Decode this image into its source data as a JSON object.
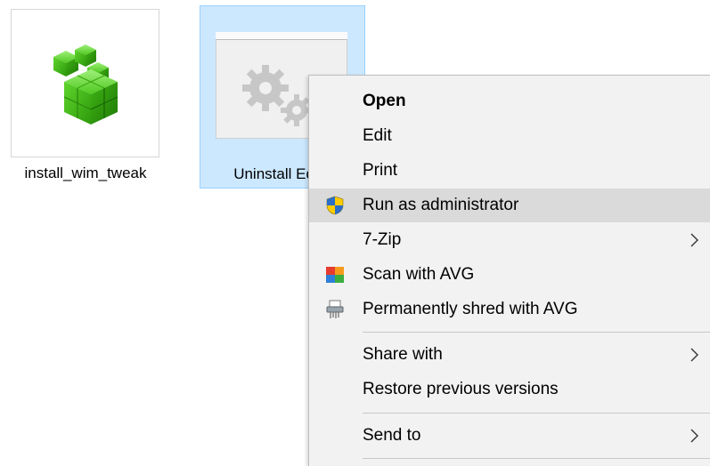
{
  "files": [
    {
      "name": "install_wim_tweak",
      "icon": "registry-cubes-icon"
    },
    {
      "name": "Uninstall Edge",
      "icon": "gears-icon"
    }
  ],
  "context_menu": {
    "items": [
      {
        "label": "Open",
        "bold": true
      },
      {
        "label": "Edit"
      },
      {
        "label": "Print"
      },
      {
        "label": "Run as administrator",
        "icon": "uac-shield-icon",
        "highlighted": true
      },
      {
        "label": "7-Zip",
        "submenu": true
      },
      {
        "label": "Scan with AVG",
        "icon": "avg-icon"
      },
      {
        "label": "Permanently shred with AVG",
        "icon": "shredder-icon"
      },
      {
        "label": "Share with",
        "submenu": true
      },
      {
        "label": "Restore previous versions"
      },
      {
        "label": "Send to",
        "submenu": true
      }
    ]
  },
  "colors": {
    "selection_bg": "#cce8ff",
    "selection_border": "#99d1ff",
    "menu_bg": "#f2f2f2",
    "menu_highlight": "#dadada"
  }
}
